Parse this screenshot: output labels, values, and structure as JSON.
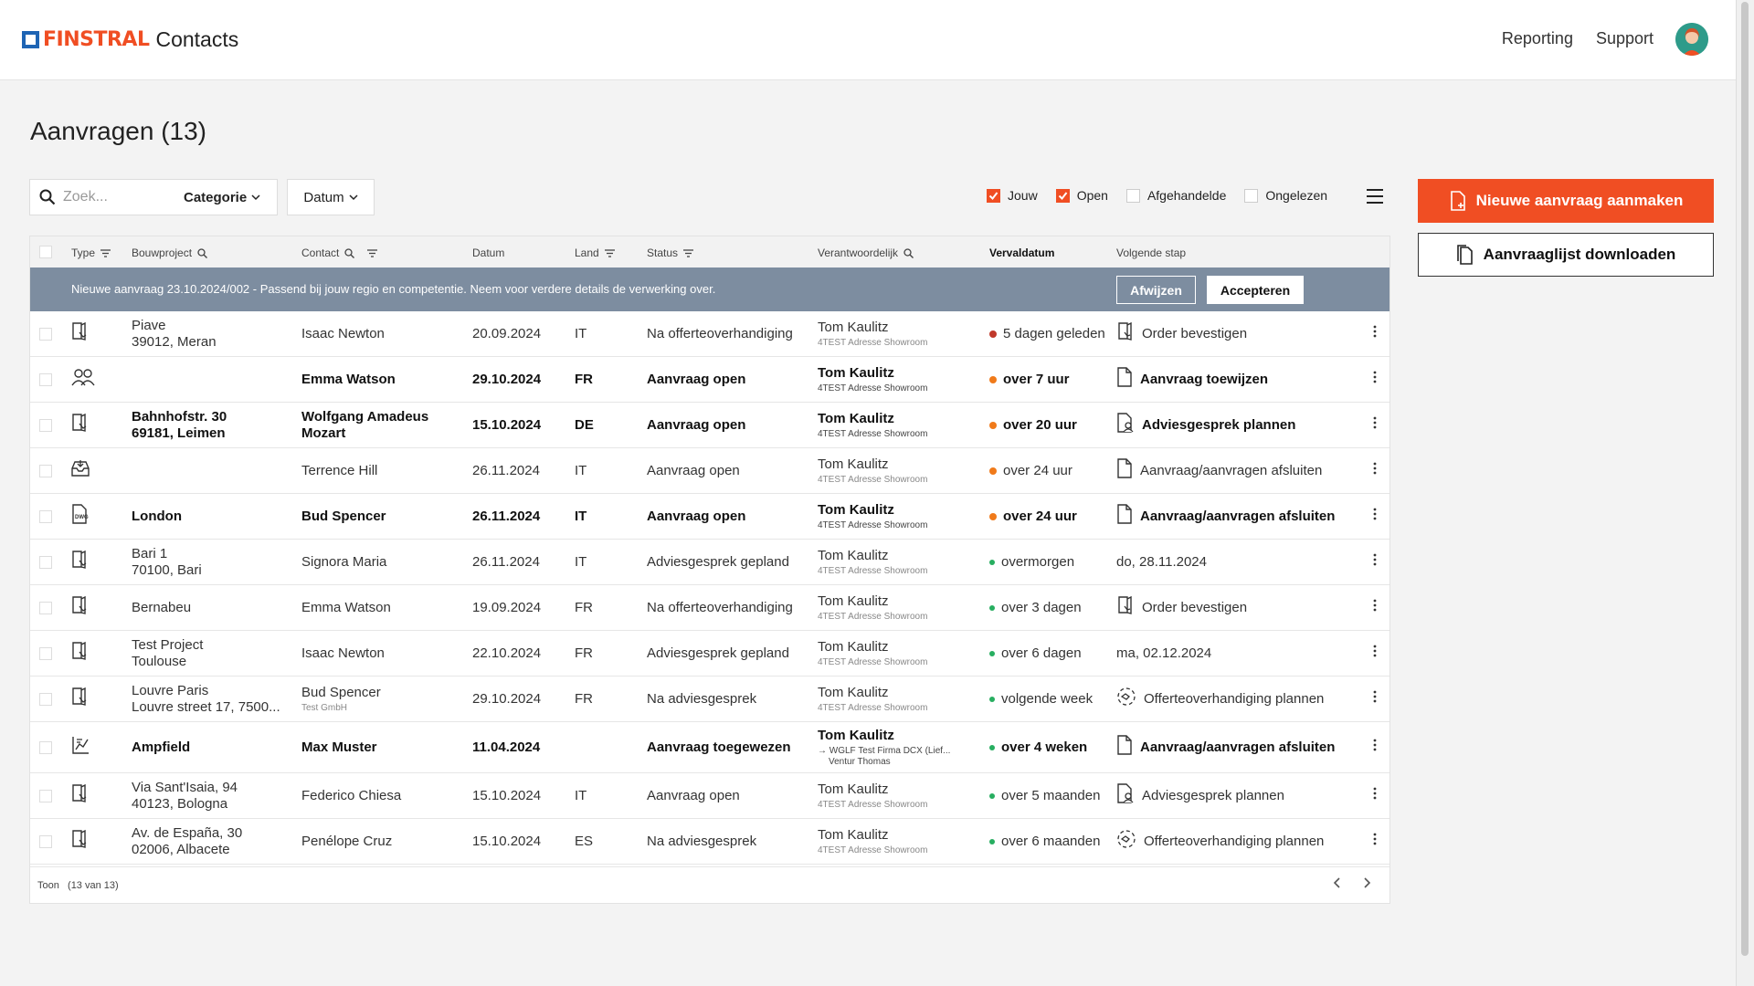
{
  "header": {
    "brand": "FINSTRAL",
    "app": "Contacts",
    "nav": [
      "Reporting",
      "Support"
    ],
    "colors": {
      "brand_orange": "#f04e23",
      "brand_blue": "#1e64b4"
    }
  },
  "page": {
    "title": "Aanvragen (13)"
  },
  "toolbar": {
    "search_placeholder": "Zoek...",
    "category_label": "Categorie",
    "date_label": "Datum",
    "filters": [
      {
        "label": "Jouw",
        "checked": true
      },
      {
        "label": "Open",
        "checked": true
      },
      {
        "label": "Afgehandelde",
        "checked": false
      },
      {
        "label": "Ongelezen",
        "checked": false
      }
    ],
    "new_button": "Nieuwe aanvraag aanmaken",
    "download_button": "Aanvraaglijst downloaden"
  },
  "table": {
    "headers": {
      "type": "Type",
      "project": "Bouwproject",
      "contact": "Contact",
      "date": "Datum",
      "land": "Land",
      "status": "Status",
      "responsible": "Verantwoordelijk",
      "due": "Vervaldatum",
      "next": "Volgende stap"
    },
    "banner": {
      "text": "Nieuwe aanvraag 23.10.2024/002 - Passend bij jouw regio en competentie. Neem voor verdere details de verwerking over.",
      "reject": "Afwijzen",
      "accept": "Accepteren"
    },
    "rows": [
      {
        "type_icon": "door-icon",
        "bold": false,
        "project": [
          "Piave",
          "39012, Meran"
        ],
        "contact": "Isaac Newton",
        "contact_sub": "",
        "date": "20.09.2024",
        "land": "IT",
        "status": "Na offerteoverhandiging",
        "resp": "Tom Kaulitz",
        "resp_sub": "4TEST Adresse Showroom",
        "resp_sub2": "",
        "due": "5 dagen geleden",
        "due_color": "#c0392b",
        "next_icon": "door-doc-icon",
        "next": "Order bevestigen"
      },
      {
        "type_icon": "people-icon",
        "bold": true,
        "project": [],
        "contact": "Emma Watson",
        "contact_sub": "",
        "date": "29.10.2024",
        "land": "FR",
        "status": "Aanvraag open",
        "resp": "Tom Kaulitz",
        "resp_sub": "4TEST Adresse Showroom",
        "resp_sub2": "",
        "due": "over 7 uur",
        "due_color": "#f07a1a",
        "next_icon": "doc-icon",
        "next": "Aanvraag toewijzen"
      },
      {
        "type_icon": "door-icon",
        "bold": true,
        "project": [
          "Bahnhofstr. 30",
          "69181, Leimen"
        ],
        "contact": "Wolfgang Amadeus Mozart",
        "contact_sub": "",
        "date": "15.10.2024",
        "land": "DE",
        "status": "Aanvraag open",
        "resp": "Tom Kaulitz",
        "resp_sub": "4TEST Adresse Showroom",
        "resp_sub2": "",
        "due": "over 20 uur",
        "due_color": "#f07a1a",
        "next_icon": "doc-person-icon",
        "next": "Adviesgesprek plannen"
      },
      {
        "type_icon": "inbox-icon",
        "bold": false,
        "project": [],
        "contact": "Terrence Hill",
        "contact_sub": "",
        "date": "26.11.2024",
        "land": "IT",
        "status": "Aanvraag open",
        "resp": "Tom Kaulitz",
        "resp_sub": "4TEST Adresse Showroom",
        "resp_sub2": "",
        "due": "over 24 uur",
        "due_color": "#f07a1a",
        "next_icon": "doc-icon",
        "next": "Aanvraag/aanvragen afsluiten"
      },
      {
        "type_icon": "dwg-icon",
        "bold": true,
        "project": [
          "London"
        ],
        "contact": "Bud Spencer",
        "contact_sub": "",
        "date": "26.11.2024",
        "land": "IT",
        "status": "Aanvraag open",
        "resp": "Tom Kaulitz",
        "resp_sub": "4TEST Adresse Showroom",
        "resp_sub2": "",
        "due": "over 24 uur",
        "due_color": "#f07a1a",
        "next_icon": "doc-icon",
        "next": "Aanvraag/aanvragen afsluiten"
      },
      {
        "type_icon": "door-icon",
        "bold": false,
        "project": [
          "Bari 1",
          "70100, Bari"
        ],
        "contact": "Signora Maria",
        "contact_sub": "",
        "date": "26.11.2024",
        "land": "IT",
        "status": "Adviesgesprek gepland",
        "resp": "Tom Kaulitz",
        "resp_sub": "4TEST Adresse Showroom",
        "resp_sub2": "",
        "due": "overmorgen",
        "due_color": "#27ae60",
        "next_icon": "",
        "next": "do, 28.11.2024"
      },
      {
        "type_icon": "door-icon",
        "bold": false,
        "project": [
          "Bernabeu"
        ],
        "contact": "Emma Watson",
        "contact_sub": "",
        "date": "19.09.2024",
        "land": "FR",
        "status": "Na offerteoverhandiging",
        "resp": "Tom Kaulitz",
        "resp_sub": "4TEST Adresse Showroom",
        "resp_sub2": "",
        "due": "over 3 dagen",
        "due_color": "#27ae60",
        "next_icon": "door-doc-icon",
        "next": "Order bevestigen"
      },
      {
        "type_icon": "door-icon",
        "bold": false,
        "project": [
          "Test Project",
          "Toulouse"
        ],
        "contact": "Isaac Newton",
        "contact_sub": "",
        "date": "22.10.2024",
        "land": "FR",
        "status": "Adviesgesprek gepland",
        "resp": "Tom Kaulitz",
        "resp_sub": "4TEST Adresse Showroom",
        "resp_sub2": "",
        "due": "over 6 dagen",
        "due_color": "#27ae60",
        "next_icon": "",
        "next": "ma, 02.12.2024"
      },
      {
        "type_icon": "door-icon",
        "bold": false,
        "project": [
          "Louvre Paris",
          "Louvre street 17, 7500..."
        ],
        "contact": "Bud Spencer",
        "contact_sub": "Test GmbH",
        "date": "29.10.2024",
        "land": "FR",
        "status": "Na adviesgesprek",
        "resp": "Tom Kaulitz",
        "resp_sub": "4TEST Adresse Showroom",
        "resp_sub2": "",
        "due": "volgende week",
        "due_color": "#27ae60",
        "next_icon": "handshake-icon",
        "next": "Offerteoverhandiging plannen"
      },
      {
        "type_icon": "chart-doc-icon",
        "bold": true,
        "project": [
          "Ampfield"
        ],
        "contact": "Max Muster",
        "contact_sub": "",
        "date": "11.04.2024",
        "land": "",
        "status": "Aanvraag toegewezen",
        "resp": "Tom Kaulitz",
        "resp_sub": "→ WGLF Test Firma DCX (Lief...",
        "resp_sub2": "Ventur Thomas",
        "due": "over 4 weken",
        "due_color": "#27ae60",
        "next_icon": "doc-icon",
        "next": "Aanvraag/aanvragen afsluiten"
      },
      {
        "type_icon": "door-icon",
        "bold": false,
        "project": [
          "Via Sant'Isaia, 94",
          "40123, Bologna"
        ],
        "contact": "Federico Chiesa",
        "contact_sub": "",
        "date": "15.10.2024",
        "land": "IT",
        "status": "Aanvraag open",
        "resp": "Tom Kaulitz",
        "resp_sub": "4TEST Adresse Showroom",
        "resp_sub2": "",
        "due": "over 5 maanden",
        "due_color": "#27ae60",
        "next_icon": "doc-person-icon",
        "next": "Adviesgesprek plannen"
      },
      {
        "type_icon": "door-icon",
        "bold": false,
        "project": [
          "Av. de España, 30",
          "02006, Albacete"
        ],
        "contact": "Penélope Cruz",
        "contact_sub": "",
        "date": "15.10.2024",
        "land": "ES",
        "status": "Na adviesgesprek",
        "resp": "Tom Kaulitz",
        "resp_sub": "4TEST Adresse Showroom",
        "resp_sub2": "",
        "due": "over 6 maanden",
        "due_color": "#27ae60",
        "next_icon": "handshake-icon",
        "next": "Offerteoverhandiging plannen"
      }
    ],
    "footer": {
      "show_label": "Toon",
      "count": "(13 van 13)"
    }
  }
}
